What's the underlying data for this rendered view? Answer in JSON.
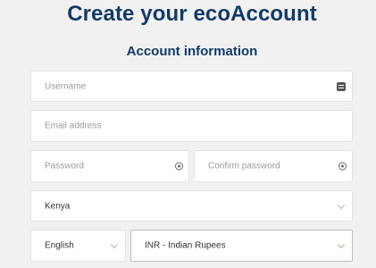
{
  "page": {
    "title": "Create your ecoAccount",
    "section_title": "Account information"
  },
  "form": {
    "username_placeholder": "Username",
    "email_placeholder": "Email address",
    "password_placeholder": "Password",
    "confirm_password_placeholder": "Confirm password",
    "country_value": "Kenya",
    "language_value": "English",
    "currency_value": "INR - Indian Rupees"
  },
  "icons": {
    "username": "keyboard-icon",
    "password": "eye-icon",
    "confirm_password": "eye-icon",
    "dropdown": "chevron-down-icon"
  },
  "colors": {
    "title": "#113b68",
    "background": "#f1f1f1",
    "chevron": "#9cbf7c"
  }
}
